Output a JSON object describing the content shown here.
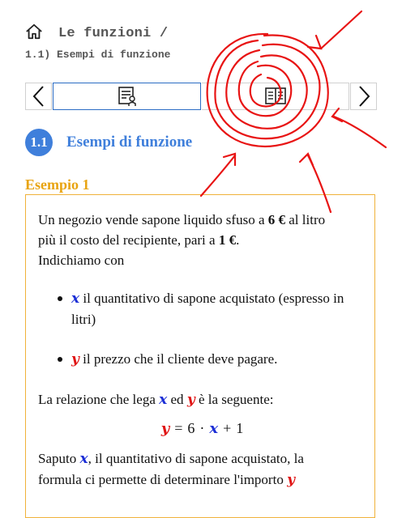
{
  "breadcrumb": {
    "title": "Le funzioni /",
    "subtitle": "1.1) Esempi di funzione"
  },
  "icons": {
    "home": "home-icon",
    "prev": "chevron-left-icon",
    "next": "chevron-right-icon",
    "tab_theory": "document-presentation-icon",
    "tab_book": "open-book-icon"
  },
  "section": {
    "number": "1.1",
    "title": "Esempi di funzione"
  },
  "example": {
    "label": "Esempio 1",
    "intro_line1": "Un negozio vende sapone liquido sfuso a ",
    "price_per_liter": "6 €",
    "intro_line1_end": " al litro",
    "intro_line2": "più il costo del recipiente, pari a ",
    "container_price": "1 €",
    "intro_line2_end": ".",
    "intro_line3": "Indichiamo con",
    "var_x": "x",
    "var_y": "y",
    "item1_text": " il quantitativo di sapone acquistato (espresso in litri)",
    "item2_text": " il prezzo che il cliente deve pagare.",
    "relation_pre": "La relazione che lega ",
    "relation_mid": " ed ",
    "relation_post": " è la seguente:",
    "formula_lhs": "y",
    "formula_eq": "=",
    "formula_coef": "6",
    "formula_dot": "·",
    "formula_var": "x",
    "formula_plus": "+",
    "formula_const": "1",
    "outro_pre": "Saputo ",
    "outro_post": ", il quantitativo di sapone acquistato, la",
    "outro_line2": "formula ci permette di determinare l'importo "
  },
  "colors": {
    "accent_blue": "#3f7fdb",
    "example_orange": "#e8a412",
    "var_x_blue": "#1c2fd6",
    "var_y_red": "#e01515",
    "annotation_red": "#e81414"
  }
}
